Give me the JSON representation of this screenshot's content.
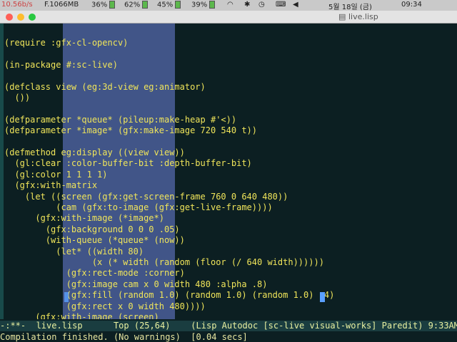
{
  "menubar": {
    "left_text": "F.1066MB",
    "left_dim": "10.56b/s",
    "battery_items": [
      "36%",
      "62%",
      "45%",
      "39%"
    ],
    "date": "5월 18일 (금)",
    "time": "09:34"
  },
  "window": {
    "title": "live.lisp"
  },
  "editor": {
    "lines": [
      "(require :gfx-cl-opencv)",
      "",
      "(in-package #:sc-live)",
      "",
      "(defclass view (eg:3d-view eg:animator)",
      "  ())",
      "",
      "(defparameter *queue* (pileup:make-heap #'<))",
      "(defparameter *image* (gfx:make-image 720 540 t))",
      "",
      "(defmethod eg:display ((view view))",
      "  (gl:clear :color-buffer-bit :depth-buffer-bit)",
      "  (gl:color 1 1 1 1)",
      "  (gfx:with-matrix",
      "    (let ((screen (gfx:get-screen-frame 760 0 640 480))",
      "          (cam (gfx:to-image (gfx:get-live-frame))))",
      "      (gfx:with-image (*image*)",
      "        (gfx:background 0 0 0 .05)",
      "        (with-queue (*queue* (now))",
      "          (let* ((width 80)",
      "                 (x (* width (random (floor (/ 640 width))))))",
      "            (gfx:rect-mode :corner)",
      "            (gfx:image cam x 0 width 480 :alpha .8)",
      "            (gfx:fill (random 1.0) (random 1.0) (random 1.0) .4)",
      "            (gfx:rect x 0 width 480))))",
      "      (gfx:with-image (screen)"
    ]
  },
  "modeline": {
    "text": "-:**-  live.lisp      Top (25,64)    (Lisp Autodoc [sc-live visual-works] Paredit) 9:33AM"
  },
  "minibuffer": {
    "text": "Compilation finished. (No warnings)  [0.04 secs]"
  },
  "colors": {
    "background": "#0c1f22",
    "code": "#f0e55a",
    "highlight": "#6e82dc",
    "modeline_bg": "#1a3d40"
  }
}
